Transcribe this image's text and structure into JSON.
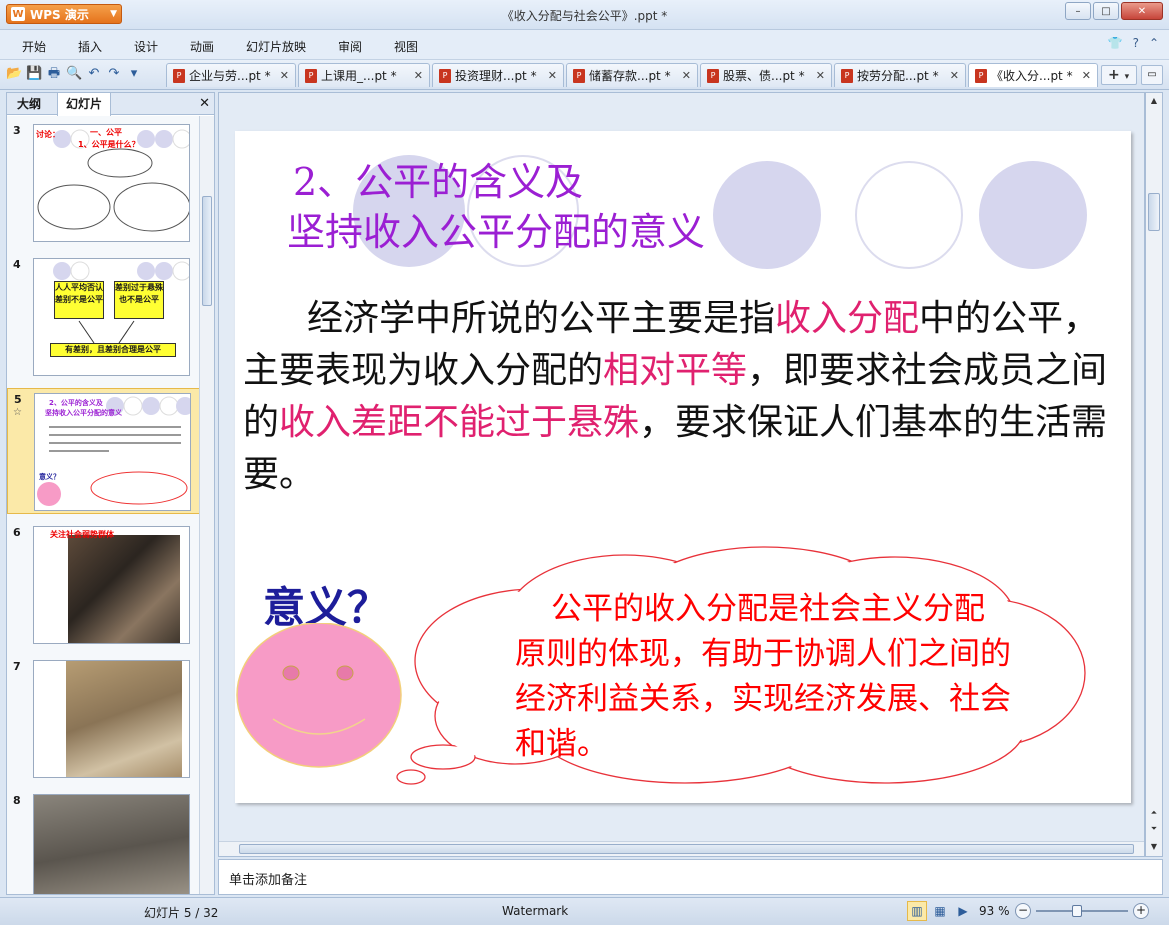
{
  "app": {
    "name": "WPS 演示",
    "logo": "W",
    "doc_title": "《收入分配与社会公平》.ppt *"
  },
  "window_controls": {
    "minimize": "–",
    "maximize": "□",
    "close": "✕"
  },
  "menu": {
    "items": [
      "开始",
      "插入",
      "设计",
      "动画",
      "幻灯片放映",
      "审阅",
      "视图"
    ],
    "right_icons": [
      "shirt-icon",
      "help-icon",
      "expand-icon"
    ]
  },
  "doc_tabs": [
    {
      "label": "企业与劳...pt *",
      "active": false
    },
    {
      "label": "上课用_...pt *",
      "active": false
    },
    {
      "label": "投资理财...pt *",
      "active": false
    },
    {
      "label": "储蓄存款...pt *",
      "active": false
    },
    {
      "label": "股票、债...pt *",
      "active": false
    },
    {
      "label": "按劳分配...pt *",
      "active": false
    },
    {
      "label": "《收入分...pt *",
      "active": true
    }
  ],
  "left_panel": {
    "tabs": [
      "大纲",
      "幻灯片"
    ],
    "active_tab": "幻灯片",
    "thumbnails": [
      {
        "number": "3",
        "title": "一、公平",
        "subtitle": "1、公平是什么？",
        "side": "讨论："
      },
      {
        "number": "4",
        "box1": "人人平均否认差别不是公平",
        "box2": "差别过于悬殊也不是公平",
        "box3": "有差别，且差别合理是公平"
      },
      {
        "number": "5",
        "selected": true,
        "title1": "2、公平的含义及",
        "title2": "坚持收入公平分配的意义",
        "q": "意义？"
      },
      {
        "number": "6",
        "caption": "关注社会弱势群体"
      },
      {
        "number": "7"
      },
      {
        "number": "8"
      }
    ]
  },
  "slide": {
    "title_line1": "2、公平的含义及",
    "title_line2": "坚持收入公平分配的意义",
    "body": {
      "p1": "经济学中所说的公平主要是指",
      "h1": "收入分配",
      "p2": "中的公平，主要表现为收入分配的",
      "h2": "相对平等",
      "p3": "，即要求社会成员之间的",
      "h3": "收入差距不能过于悬殊",
      "p4": "，要求保证人们基本的生活需要。"
    },
    "question": "意义？",
    "cloud_text": "公平的收入分配是社会主义分配原则的体现，有助于协调人们之间的经济利益关系，实现经济发展、社会和谐。",
    "colors": {
      "title": "#9b1fd3",
      "highlight": "#e0216f",
      "cloud": "#ff0000",
      "question": "#1d1d9a",
      "smiley": "#f79bc6"
    }
  },
  "notes_placeholder": "单击添加备注",
  "status": {
    "slide_info": "幻灯片 5 / 32",
    "watermark": "Watermark",
    "zoom": "93 %",
    "zoom_level_percent": 93
  }
}
